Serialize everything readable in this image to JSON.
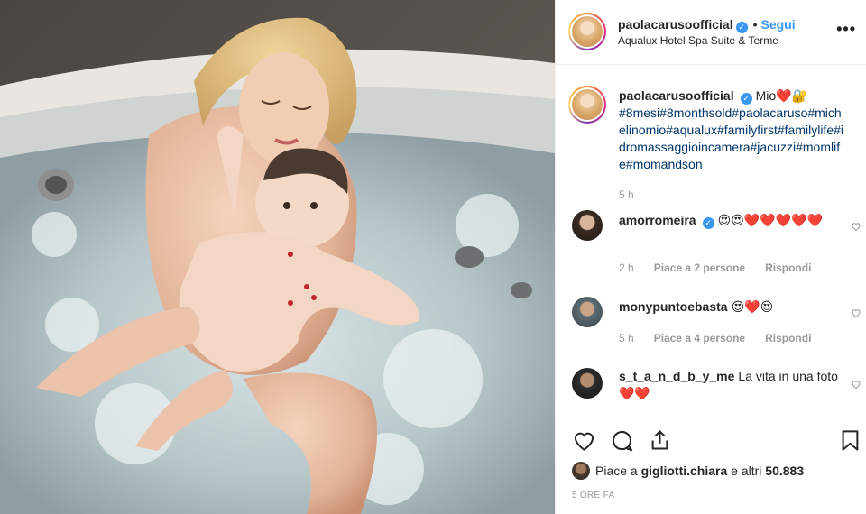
{
  "post": {
    "author": "paolacarusoofficial",
    "dot": "•",
    "follow_label": "Segui",
    "location": "Aqualux Hotel Spa Suite & Terme",
    "more_label": "•••"
  },
  "caption": {
    "username": "paolacarusoofficial",
    "text_prefix": "Mio❤️🔐",
    "hashtags": "#8mesi#8monthsold#paolacaruso#michelinomio#aqualux#familyfirst#familylife#idromassaggioincamera#jacuzzi#momlife#momandson",
    "time": "5 h"
  },
  "comments": [
    {
      "username": "amorromeira",
      "verified": true,
      "text": "😍😍❤️❤️❤️❤️❤️",
      "time": "2 h",
      "likes": "Piace a 2 persone",
      "reply": "Rispondi"
    },
    {
      "username": "monypuntoebasta",
      "verified": false,
      "text": "😍❤️😍",
      "time": "5 h",
      "likes": "Piace a 4 persone",
      "reply": "Rispondi"
    },
    {
      "username": "s_t_a_n_d_b_y_me",
      "verified": false,
      "text": "La vita in una foto❤️❤️",
      "time": "",
      "likes": "",
      "reply": ""
    }
  ],
  "likes": {
    "prefix": "Piace a",
    "user": "gigliotti.chiara",
    "middle": "e altri",
    "count": "50.883"
  },
  "time_ago": "5 ORE FA",
  "icons": {
    "like": "heart-outline-icon",
    "comment": "comment-bubble-icon",
    "share": "share-icon",
    "save": "bookmark-icon",
    "verified": "verified-badge-icon"
  },
  "colors": {
    "link_blue": "#3897f0",
    "hashtag": "#003569",
    "muted": "#999999",
    "text": "#262626"
  }
}
